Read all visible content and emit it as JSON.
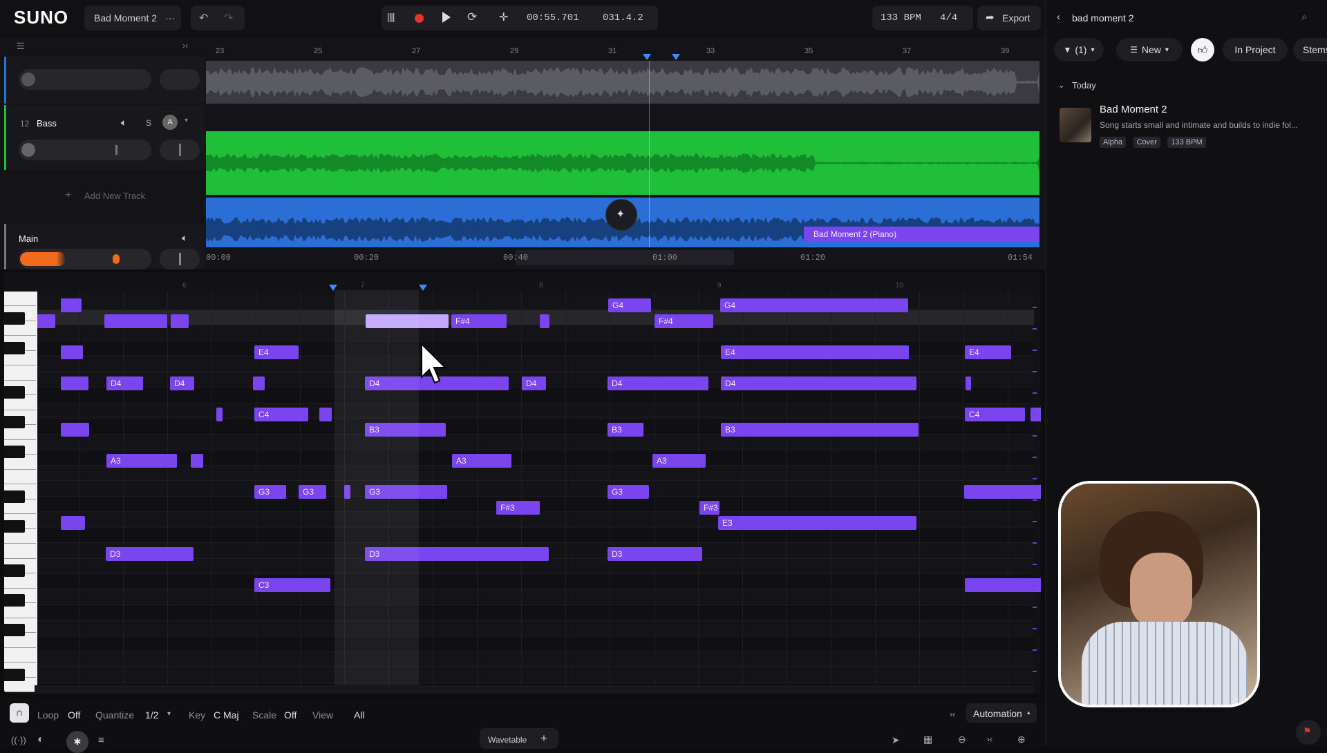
{
  "app": {
    "logo": "SUNO",
    "project_name": "Bad Moment 2",
    "more_icon": "more-icon"
  },
  "transport": {
    "time": "00:55.701",
    "position": "031.4.2",
    "bpm": "133 BPM",
    "time_signature": "4/4",
    "export_label": "Export"
  },
  "timeline": {
    "bar_numbers": [
      "23",
      "25",
      "27",
      "29",
      "31",
      "33",
      "35",
      "37",
      "39"
    ],
    "time_labels": [
      "00:00",
      "00:20",
      "00:40",
      "01:00",
      "01:20",
      "01:54"
    ]
  },
  "tracks": [
    {
      "number": "12",
      "name": "Bass",
      "solo": "S",
      "auto": "A"
    }
  ],
  "add_track_label": "Add New Track",
  "main_track": {
    "name": "Main"
  },
  "clip_label": "Bad Moment 2 (Piano)",
  "piano_roll": {
    "bar_markers": [
      "6",
      "7",
      "8",
      "9",
      "10"
    ],
    "notes": [
      {
        "label": "",
        "row": 0,
        "start": 38,
        "len": 30
      },
      {
        "label": "G4",
        "row": 0,
        "start": 830,
        "len": 62
      },
      {
        "label": "G4",
        "row": 0,
        "start": 992,
        "len": 272
      },
      {
        "label": "",
        "row": 1,
        "start": 0,
        "len": 30
      },
      {
        "label": "",
        "row": 1,
        "start": 101,
        "len": 91
      },
      {
        "label": "",
        "row": 1,
        "start": 197,
        "len": 26
      },
      {
        "label": "",
        "row": 1,
        "start": 479,
        "len": 120,
        "selected": true
      },
      {
        "label": "F#4",
        "row": 1,
        "start": 603,
        "len": 80
      },
      {
        "label": "",
        "row": 1,
        "start": 731,
        "len": 14
      },
      {
        "label": "F#4",
        "row": 1,
        "start": 897,
        "len": 85
      },
      {
        "label": "",
        "row": 3,
        "start": 38,
        "len": 32
      },
      {
        "label": "E4",
        "row": 3,
        "start": 318,
        "len": 64
      },
      {
        "label": "E4",
        "row": 3,
        "start": 993,
        "len": 272
      },
      {
        "label": "E4",
        "row": 3,
        "start": 1346,
        "len": 67
      },
      {
        "label": "",
        "row": 5,
        "start": 38,
        "len": 40
      },
      {
        "label": "D4",
        "row": 5,
        "start": 104,
        "len": 53
      },
      {
        "label": "D4",
        "row": 5,
        "start": 196,
        "len": 35
      },
      {
        "label": "",
        "row": 5,
        "start": 316,
        "len": 17
      },
      {
        "label": "D4",
        "row": 5,
        "start": 478,
        "len": 208
      },
      {
        "label": "D4",
        "row": 5,
        "start": 705,
        "len": 35
      },
      {
        "label": "D4",
        "row": 5,
        "start": 829,
        "len": 146
      },
      {
        "label": "D4",
        "row": 5,
        "start": 993,
        "len": 283
      },
      {
        "label": "",
        "row": 5,
        "start": 1347,
        "len": 8
      },
      {
        "label": "",
        "row": 7,
        "start": 263,
        "len": 9
      },
      {
        "label": "C4",
        "row": 7,
        "start": 318,
        "len": 78
      },
      {
        "label": "",
        "row": 7,
        "start": 412,
        "len": 18
      },
      {
        "label": "C4",
        "row": 7,
        "start": 1346,
        "len": 87
      },
      {
        "label": "",
        "row": 7,
        "start": 1441,
        "len": 20
      },
      {
        "label": "",
        "row": 8,
        "start": 38,
        "len": 41
      },
      {
        "label": "B3",
        "row": 8,
        "start": 478,
        "len": 117
      },
      {
        "label": "B3",
        "row": 8,
        "start": 829,
        "len": 52
      },
      {
        "label": "B3",
        "row": 8,
        "start": 993,
        "len": 286
      },
      {
        "label": "A3",
        "row": 10,
        "start": 104,
        "len": 102
      },
      {
        "label": "",
        "row": 10,
        "start": 226,
        "len": 18
      },
      {
        "label": "A3",
        "row": 10,
        "start": 604,
        "len": 86
      },
      {
        "label": "A3",
        "row": 10,
        "start": 894,
        "len": 77
      },
      {
        "label": "G3",
        "row": 12,
        "start": 318,
        "len": 46
      },
      {
        "label": "G3",
        "row": 12,
        "start": 382,
        "len": 40
      },
      {
        "label": "",
        "row": 12,
        "start": 448,
        "len": 9
      },
      {
        "label": "G3",
        "row": 12,
        "start": 478,
        "len": 119
      },
      {
        "label": "G3",
        "row": 12,
        "start": 829,
        "len": 60
      },
      {
        "label": "",
        "row": 12,
        "start": 1345,
        "len": 122
      },
      {
        "label": "F#3",
        "row": 13,
        "start": 668,
        "len": 63
      },
      {
        "label": "F#3",
        "row": 13,
        "start": 962,
        "len": 29
      },
      {
        "label": "",
        "row": 14,
        "start": 38,
        "len": 35
      },
      {
        "label": "E3",
        "row": 14,
        "start": 989,
        "len": 287
      },
      {
        "label": "D3",
        "row": 16,
        "start": 103,
        "len": 127
      },
      {
        "label": "D3",
        "row": 16,
        "start": 478,
        "len": 266
      },
      {
        "label": "D3",
        "row": 16,
        "start": 829,
        "len": 137
      },
      {
        "label": "C3",
        "row": 18,
        "start": 318,
        "len": 110
      },
      {
        "label": "",
        "row": 18,
        "start": 1346,
        "len": 114
      }
    ]
  },
  "bottom_bar": {
    "loop_label": "Loop",
    "loop_value": "Off",
    "quantize_label": "Quantize",
    "quantize_value": "1/2",
    "key_label": "Key",
    "key_value": "C Maj",
    "scale_label": "Scale",
    "scale_value": "Off",
    "view_label": "View",
    "view_value": "All",
    "automation_label": "Automation",
    "instrument_label": "Wavetable"
  },
  "library": {
    "search_title": "bad moment 2",
    "filter_label": "(1)",
    "sort_label": "New",
    "in_project_label": "In Project",
    "stems_label": "Stems",
    "section_label": "Today",
    "song": {
      "title": "Bad Moment 2",
      "description": "Song starts small and intimate and builds to indie fol...",
      "tags": [
        "Alpha",
        "Cover",
        "133 BPM"
      ]
    }
  },
  "colors": {
    "accent": "#7a45ee",
    "bass_track": "#1fbf3a",
    "piano_track": "#2b6fd6",
    "record": "#e5332a",
    "main_meter": "#f26a1b"
  }
}
